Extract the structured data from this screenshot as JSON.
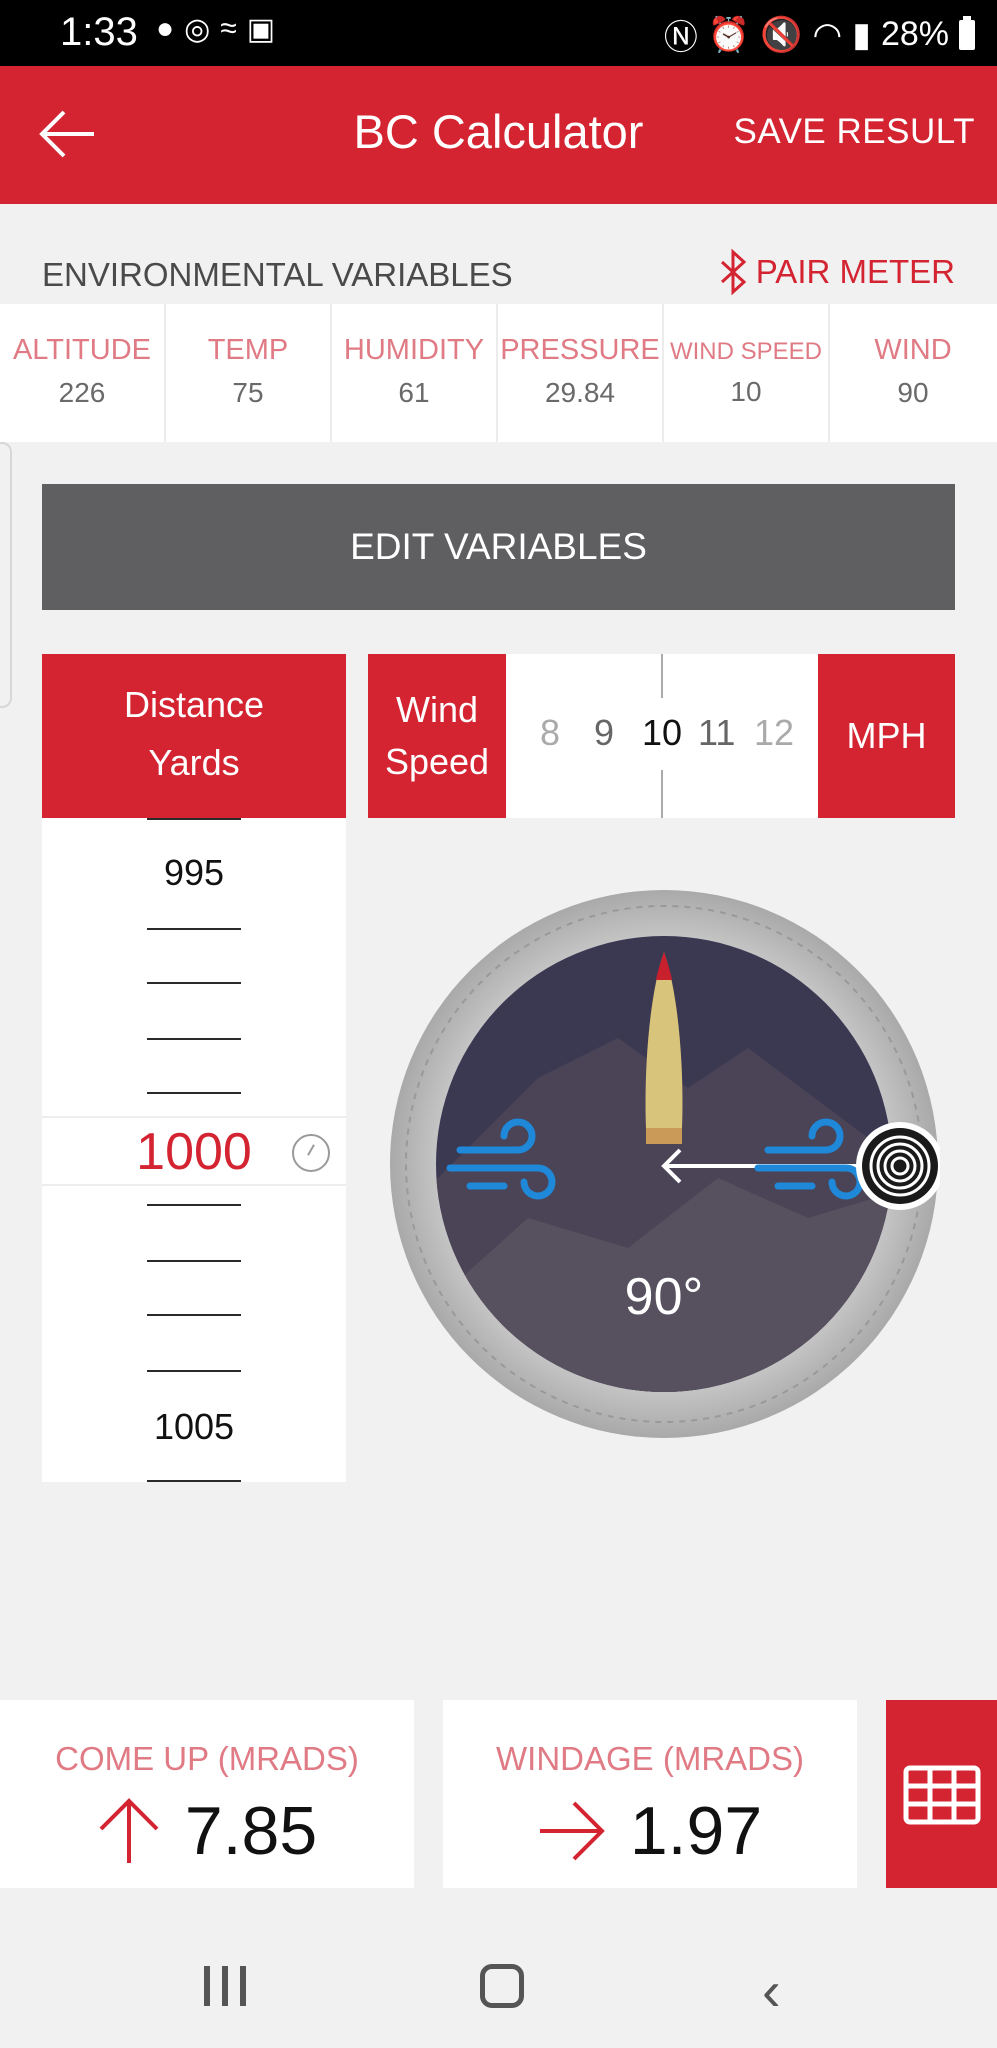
{
  "status_bar": {
    "time": "1:33",
    "battery": "28%",
    "left_icons": [
      "messenger-icon",
      "chrome-icon",
      "app-icon",
      "gallery-icon"
    ],
    "right_icons": [
      "nfc-icon",
      "alarm-icon",
      "mute-icon",
      "wifi-icon",
      "signal-icon",
      "battery-icon"
    ]
  },
  "app_bar": {
    "title": "BC Calculator",
    "save_label": "SAVE RESULT"
  },
  "environment": {
    "header": "ENVIRONMENTAL VARIABLES",
    "pair_label": "PAIR METER",
    "variables": [
      {
        "label": "ALTITUDE",
        "value": "226"
      },
      {
        "label": "TEMP",
        "value": "75"
      },
      {
        "label": "HUMIDITY",
        "value": "61"
      },
      {
        "label": "PRESSURE",
        "value": "29.84"
      },
      {
        "label": "WIND SPEED",
        "value": "10"
      },
      {
        "label": "WIND",
        "value": "90"
      }
    ],
    "edit_label": "EDIT VARIABLES"
  },
  "distance": {
    "header_line1": "Distance",
    "header_line2": "Yards",
    "top_value": "995",
    "selected_value": "1000",
    "bottom_value": "1005"
  },
  "wind_speed": {
    "header_line1": "Wind",
    "header_line2": "Speed",
    "options": [
      "8",
      "9",
      "10",
      "11",
      "12"
    ],
    "selected": "10",
    "unit": "MPH"
  },
  "dial": {
    "angle_label": "90°"
  },
  "results": {
    "come_up_label": "COME UP (MRADS)",
    "come_up_value": "7.85",
    "windage_label": "WINDAGE (MRADS)",
    "windage_value": "1.97"
  },
  "colors": {
    "brand_red": "#d42431",
    "label_pink": "#e07a84",
    "dial_bg": "#3b3852",
    "wind_blue": "#1f88d8"
  }
}
